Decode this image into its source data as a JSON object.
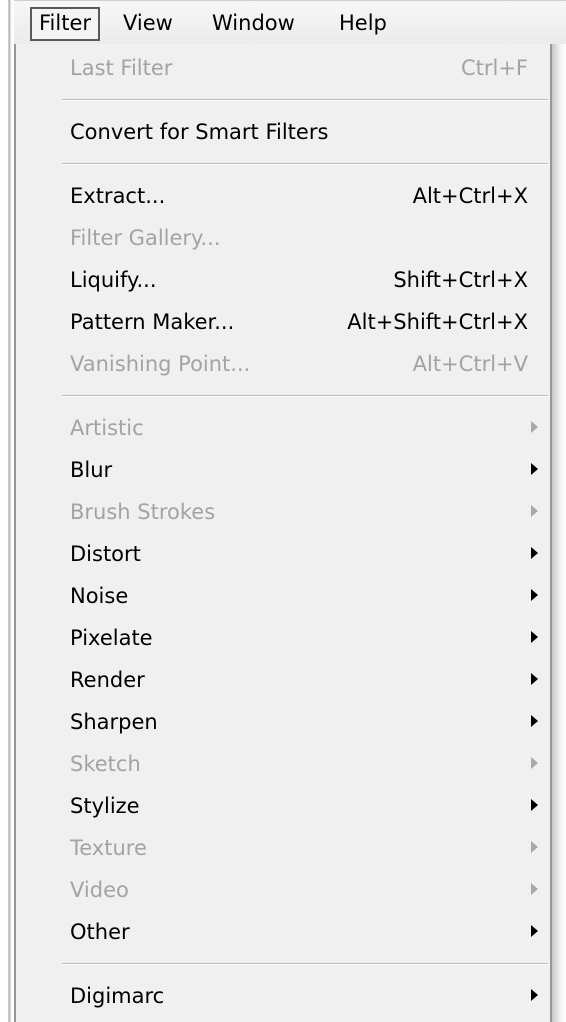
{
  "menubar": {
    "items": [
      {
        "label": "Filter",
        "active": true
      },
      {
        "label": "View",
        "active": false
      },
      {
        "label": "Window",
        "active": false
      },
      {
        "label": "Help",
        "active": false
      }
    ]
  },
  "menu": {
    "groups": [
      [
        {
          "label": "Last Filter",
          "shortcut": "Ctrl+F",
          "enabled": false,
          "submenu": false
        }
      ],
      [
        {
          "label": "Convert for Smart Filters",
          "shortcut": "",
          "enabled": true,
          "submenu": false
        }
      ],
      [
        {
          "label": "Extract...",
          "shortcut": "Alt+Ctrl+X",
          "enabled": true,
          "submenu": false
        },
        {
          "label": "Filter Gallery...",
          "shortcut": "",
          "enabled": false,
          "submenu": false
        },
        {
          "label": "Liquify...",
          "shortcut": "Shift+Ctrl+X",
          "enabled": true,
          "submenu": false
        },
        {
          "label": "Pattern Maker...",
          "shortcut": "Alt+Shift+Ctrl+X",
          "enabled": true,
          "submenu": false
        },
        {
          "label": "Vanishing Point...",
          "shortcut": "Alt+Ctrl+V",
          "enabled": false,
          "submenu": false
        }
      ],
      [
        {
          "label": "Artistic",
          "shortcut": "",
          "enabled": false,
          "submenu": true
        },
        {
          "label": "Blur",
          "shortcut": "",
          "enabled": true,
          "submenu": true
        },
        {
          "label": "Brush Strokes",
          "shortcut": "",
          "enabled": false,
          "submenu": true
        },
        {
          "label": "Distort",
          "shortcut": "",
          "enabled": true,
          "submenu": true
        },
        {
          "label": "Noise",
          "shortcut": "",
          "enabled": true,
          "submenu": true
        },
        {
          "label": "Pixelate",
          "shortcut": "",
          "enabled": true,
          "submenu": true
        },
        {
          "label": "Render",
          "shortcut": "",
          "enabled": true,
          "submenu": true
        },
        {
          "label": "Sharpen",
          "shortcut": "",
          "enabled": true,
          "submenu": true
        },
        {
          "label": "Sketch",
          "shortcut": "",
          "enabled": false,
          "submenu": true
        },
        {
          "label": "Stylize",
          "shortcut": "",
          "enabled": true,
          "submenu": true
        },
        {
          "label": "Texture",
          "shortcut": "",
          "enabled": false,
          "submenu": true
        },
        {
          "label": "Video",
          "shortcut": "",
          "enabled": false,
          "submenu": true
        },
        {
          "label": "Other",
          "shortcut": "",
          "enabled": true,
          "submenu": true
        }
      ],
      [
        {
          "label": "Digimarc",
          "shortcut": "",
          "enabled": true,
          "submenu": true
        }
      ]
    ]
  },
  "colors": {
    "menu_background": "#f0f0f0",
    "text_enabled": "#000000",
    "text_disabled": "#a3a3a3",
    "separator": "#bdbdbd"
  }
}
